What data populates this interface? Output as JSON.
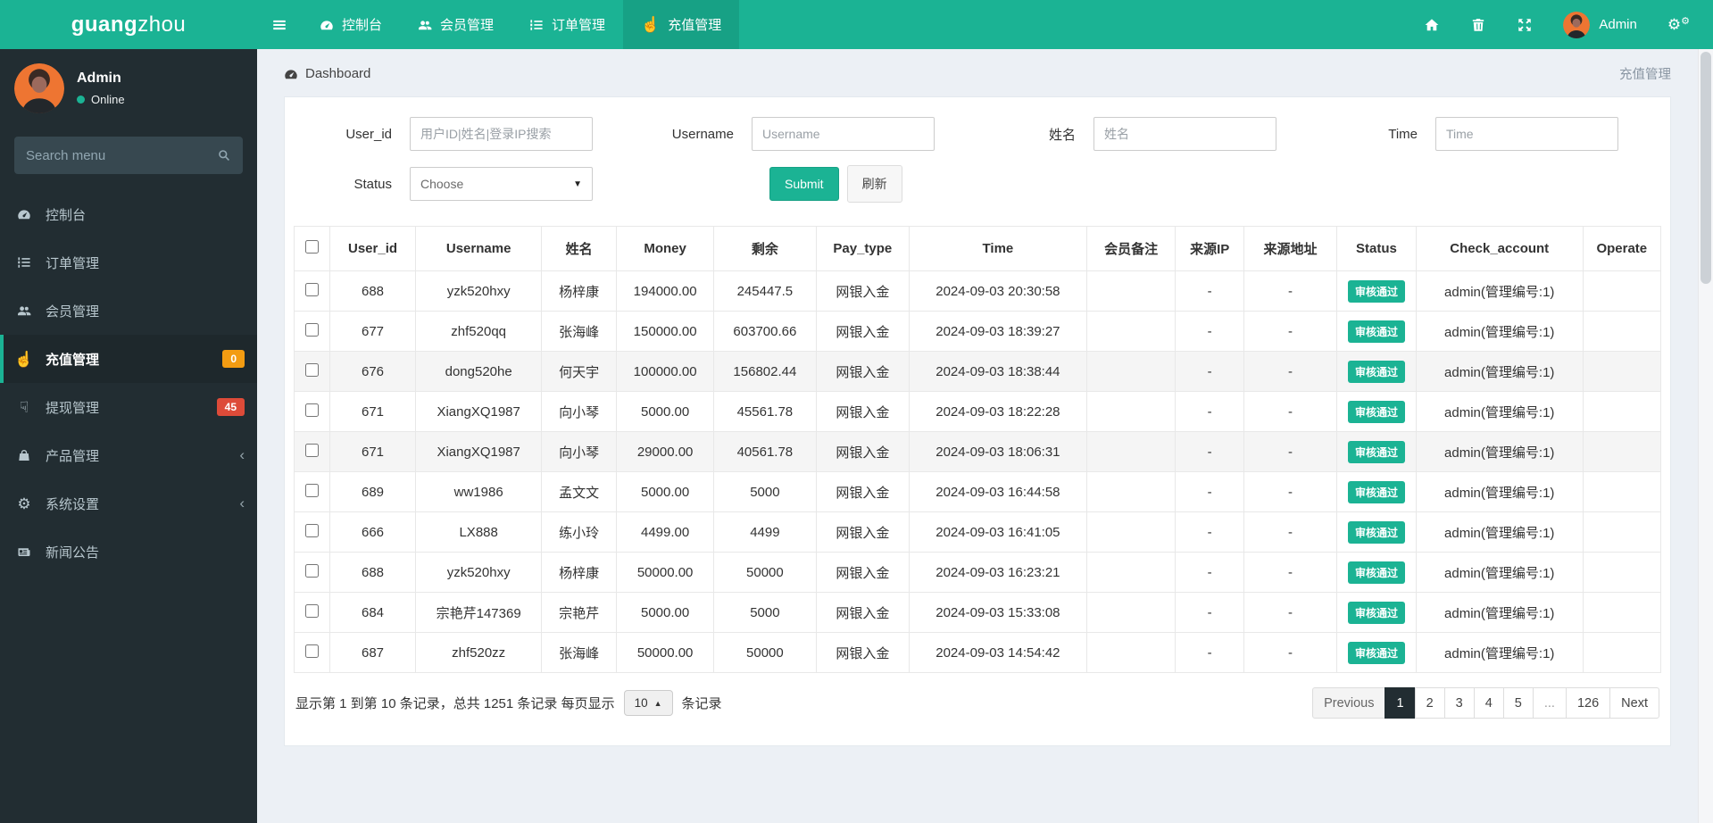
{
  "colors": {
    "accent": "#1bb394",
    "accent_dark": "#17a185",
    "badge_orange": "#f39c12",
    "badge_red": "#dd4b39"
  },
  "navbar": {
    "logo_bold": "guang",
    "logo_light": "zhou",
    "menu": [
      {
        "label": "控制台",
        "icon": "gauge",
        "active": false
      },
      {
        "label": "会员管理",
        "icon": "users",
        "active": false
      },
      {
        "label": "订单管理",
        "icon": "list-ol",
        "active": false
      },
      {
        "label": "充值管理",
        "icon": "hand-up",
        "active": true
      }
    ],
    "user_name": "Admin"
  },
  "sidebar": {
    "user_name": "Admin",
    "user_status": "Online",
    "search_placeholder": "Search menu",
    "menu": [
      {
        "label": "控制台",
        "icon": "gauge"
      },
      {
        "label": "订单管理",
        "icon": "list-ol"
      },
      {
        "label": "会员管理",
        "icon": "users"
      },
      {
        "label": "充值管理",
        "icon": "hand-up",
        "active": true,
        "badge": "0",
        "badge_color": "#f39c12"
      },
      {
        "label": "提现管理",
        "icon": "hand-down",
        "badge": "45",
        "badge_color": "#dd4b39"
      },
      {
        "label": "产品管理",
        "icon": "bag",
        "arrow": true
      },
      {
        "label": "系统设置",
        "icon": "cogs",
        "arrow": true
      },
      {
        "label": "新闻公告",
        "icon": "newspaper"
      }
    ]
  },
  "header": {
    "breadcrumb": "Dashboard",
    "page_label": "充值管理"
  },
  "filters": {
    "user_id": {
      "label": "User_id",
      "placeholder": "用户ID|姓名|登录IP搜索",
      "value": ""
    },
    "username": {
      "label": "Username",
      "placeholder": "Username",
      "value": ""
    },
    "name": {
      "label": "姓名",
      "placeholder": "姓名",
      "value": ""
    },
    "time": {
      "label": "Time",
      "placeholder": "Time",
      "value": ""
    },
    "status": {
      "label": "Status",
      "value": "Choose"
    },
    "submit_label": "Submit",
    "refresh_label": "刷新"
  },
  "table": {
    "columns": [
      "User_id",
      "Username",
      "姓名",
      "Money",
      "剩余",
      "Pay_type",
      "Time",
      "会员备注",
      "来源IP",
      "来源地址",
      "Status",
      "Check_account",
      "Operate"
    ],
    "rows": [
      {
        "user_id": "688",
        "username": "yzk520hxy",
        "name": "杨梓康",
        "money": "194000.00",
        "remain": "245447.5",
        "pay_type": "网银入金",
        "time": "2024-09-03 20:30:58",
        "remark": "",
        "source_ip": "-",
        "source_addr": "-",
        "status": "审核通过",
        "check_account": "admin(管理编号:1)",
        "operate": ""
      },
      {
        "user_id": "677",
        "username": "zhf520qq",
        "name": "张海峰",
        "money": "150000.00",
        "remain": "603700.66",
        "pay_type": "网银入金",
        "time": "2024-09-03 18:39:27",
        "remark": "",
        "source_ip": "-",
        "source_addr": "-",
        "status": "审核通过",
        "check_account": "admin(管理编号:1)",
        "operate": ""
      },
      {
        "user_id": "676",
        "username": "dong520he",
        "name": "何天宇",
        "money": "100000.00",
        "remain": "156802.44",
        "pay_type": "网银入金",
        "time": "2024-09-03 18:38:44",
        "remark": "",
        "source_ip": "-",
        "source_addr": "-",
        "status": "审核通过",
        "check_account": "admin(管理编号:1)",
        "operate": ""
      },
      {
        "user_id": "671",
        "username": "XiangXQ1987",
        "name": "向小琴",
        "money": "5000.00",
        "remain": "45561.78",
        "pay_type": "网银入金",
        "time": "2024-09-03 18:22:28",
        "remark": "",
        "source_ip": "-",
        "source_addr": "-",
        "status": "审核通过",
        "check_account": "admin(管理编号:1)",
        "operate": ""
      },
      {
        "user_id": "671",
        "username": "XiangXQ1987",
        "name": "向小琴",
        "money": "29000.00",
        "remain": "40561.78",
        "pay_type": "网银入金",
        "time": "2024-09-03 18:06:31",
        "remark": "",
        "source_ip": "-",
        "source_addr": "-",
        "status": "审核通过",
        "check_account": "admin(管理编号:1)",
        "operate": ""
      },
      {
        "user_id": "689",
        "username": "ww1986",
        "name": "孟文文",
        "money": "5000.00",
        "remain": "5000",
        "pay_type": "网银入金",
        "time": "2024-09-03 16:44:58",
        "remark": "",
        "source_ip": "-",
        "source_addr": "-",
        "status": "审核通过",
        "check_account": "admin(管理编号:1)",
        "operate": ""
      },
      {
        "user_id": "666",
        "username": "LX888",
        "name": "练小玲",
        "money": "4499.00",
        "remain": "4499",
        "pay_type": "网银入金",
        "time": "2024-09-03 16:41:05",
        "remark": "",
        "source_ip": "-",
        "source_addr": "-",
        "status": "审核通过",
        "check_account": "admin(管理编号:1)",
        "operate": ""
      },
      {
        "user_id": "688",
        "username": "yzk520hxy",
        "name": "杨梓康",
        "money": "50000.00",
        "remain": "50000",
        "pay_type": "网银入金",
        "time": "2024-09-03 16:23:21",
        "remark": "",
        "source_ip": "-",
        "source_addr": "-",
        "status": "审核通过",
        "check_account": "admin(管理编号:1)",
        "operate": ""
      },
      {
        "user_id": "684",
        "username": "宗艳芹147369",
        "name": "宗艳芹",
        "money": "5000.00",
        "remain": "5000",
        "pay_type": "网银入金",
        "time": "2024-09-03 15:33:08",
        "remark": "",
        "source_ip": "-",
        "source_addr": "-",
        "status": "审核通过",
        "check_account": "admin(管理编号:1)",
        "operate": ""
      },
      {
        "user_id": "687",
        "username": "zhf520zz",
        "name": "张海峰",
        "money": "50000.00",
        "remain": "50000",
        "pay_type": "网银入金",
        "time": "2024-09-03 14:54:42",
        "remark": "",
        "source_ip": "-",
        "source_addr": "-",
        "status": "审核通过",
        "check_account": "admin(管理编号:1)",
        "operate": ""
      }
    ]
  },
  "pagination": {
    "summary_before": "显示第 1 到第 10 条记录，总共 1251 条记录 每页显示",
    "page_size": "10",
    "summary_after": "条记录",
    "previous_label": "Previous",
    "pages": [
      "1",
      "2",
      "3",
      "4",
      "5",
      "...",
      "126"
    ],
    "active_page": "1",
    "next_label": "Next"
  }
}
